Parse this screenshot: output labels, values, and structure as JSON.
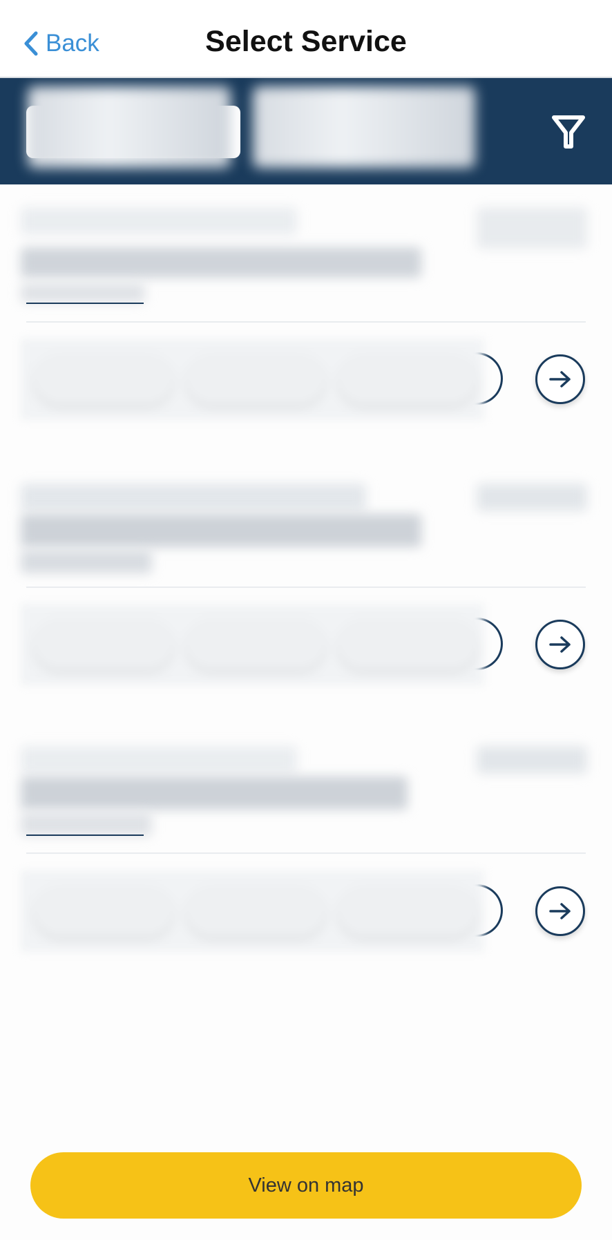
{
  "header": {
    "back_label": "Back",
    "title": "Select Service"
  },
  "filters": {
    "icon": "filter-icon"
  },
  "footer": {
    "map_button_label": "View on map"
  },
  "colors": {
    "navy": "#1a3b5c",
    "link_blue": "#3a8fd6",
    "accent_yellow": "#f6c217"
  }
}
